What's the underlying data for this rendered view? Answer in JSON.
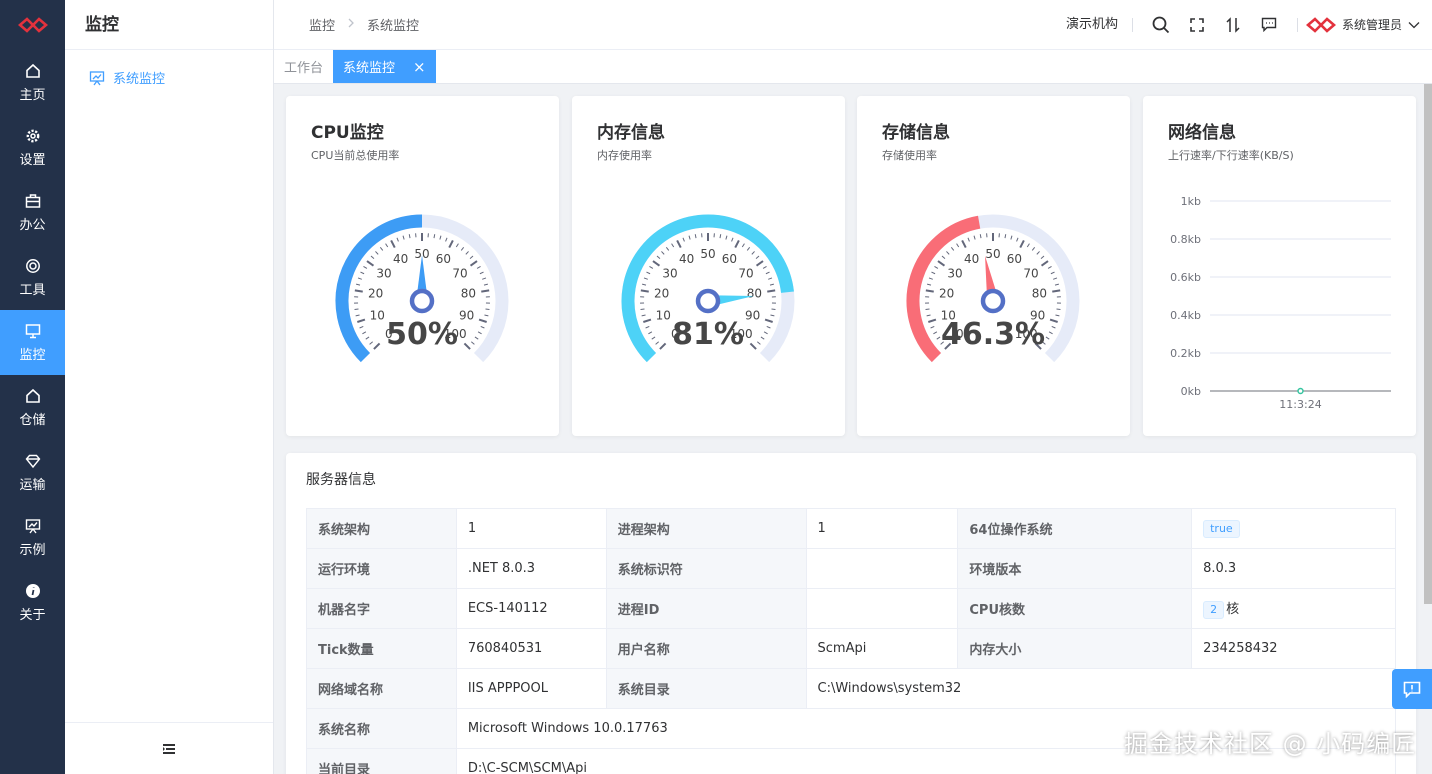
{
  "sidebar": {
    "items": [
      {
        "label": "主页",
        "icon": "home-icon"
      },
      {
        "label": "设置",
        "icon": "gear-icon"
      },
      {
        "label": "办公",
        "icon": "briefcase-icon"
      },
      {
        "label": "工具",
        "icon": "lifebuoy-icon"
      },
      {
        "label": "监控",
        "icon": "monitor-icon",
        "active": true
      },
      {
        "label": "仓储",
        "icon": "warehouse-icon"
      },
      {
        "label": "运输",
        "icon": "diamond-icon"
      },
      {
        "label": "示例",
        "icon": "presentation-icon"
      },
      {
        "label": "关于",
        "icon": "info-icon"
      }
    ]
  },
  "submenu": {
    "title": "监控",
    "items": [
      {
        "label": "系统监控",
        "icon": "chart-board-icon"
      }
    ]
  },
  "header": {
    "breadcrumb": [
      "监控",
      "系统监控"
    ],
    "org": "演示机构",
    "user": "系统管理员",
    "icons": [
      "search-icon",
      "fullscreen-icon",
      "sort-icon",
      "message-icon"
    ]
  },
  "tabs": [
    {
      "label": "工作台"
    },
    {
      "label": "系统监控",
      "active": true,
      "close": "×"
    }
  ],
  "cards": {
    "cpu": {
      "title": "CPU监控",
      "subtitle": "CPU当前总使用率",
      "value": 50,
      "display": "50%",
      "color": "#3d9cf5"
    },
    "memory": {
      "title": "内存信息",
      "subtitle": "内存使用率",
      "value": 81,
      "display": "81%",
      "color": "#4dd2f7"
    },
    "storage": {
      "title": "存储信息",
      "subtitle": "存储使用率",
      "value": 46.3,
      "display": "46.3%",
      "color": "#f96d77"
    },
    "network": {
      "title": "网络信息",
      "subtitle": "上行速率/下行速率(KB/S)"
    }
  },
  "gauge_ticks": [
    "0",
    "10",
    "20",
    "30",
    "40",
    "50",
    "60",
    "70",
    "80",
    "90",
    "100"
  ],
  "chart_data": {
    "type": "line",
    "x": [
      "11:3:24"
    ],
    "series": [
      {
        "values": [
          0
        ]
      }
    ],
    "y_ticks": [
      "0kb",
      "0.2kb",
      "0.4kb",
      "0.6kb",
      "0.8kb",
      "1kb"
    ],
    "ylim": [
      0,
      1
    ],
    "grid": true
  },
  "server": {
    "title": "服务器信息",
    "rows": [
      [
        {
          "k": "系统架构",
          "v": "1"
        },
        {
          "k": "进程架构",
          "v": "1"
        },
        {
          "k": "64位操作系统",
          "v": "true",
          "tag": true
        }
      ],
      [
        {
          "k": "运行环境",
          "v": ".NET 8.0.3"
        },
        {
          "k": "系统标识符",
          "v": ""
        },
        {
          "k": "环境版本",
          "v": "8.0.3"
        }
      ],
      [
        {
          "k": "机器名字",
          "v": "ECS-140112"
        },
        {
          "k": "进程ID",
          "v": ""
        },
        {
          "k": "CPU核数",
          "v": "2",
          "suffix": "核",
          "tag": true
        }
      ],
      [
        {
          "k": "Tick数量",
          "v": "760840531"
        },
        {
          "k": "用户名称",
          "v": "ScmApi"
        },
        {
          "k": "内存大小",
          "v": "234258432"
        }
      ],
      [
        {
          "k": "网络域名称",
          "v": "IIS APPPOOL"
        },
        {
          "k": "系统目录",
          "v": "C:\\Windows\\system32",
          "span": 3
        }
      ],
      [
        {
          "k": "系统名称",
          "v": "Microsoft Windows 10.0.17763",
          "span": 5
        }
      ],
      [
        {
          "k": "当前目录",
          "v": "D:\\C-SCM\\SCM\\Api",
          "span": 5
        }
      ]
    ]
  },
  "watermark": "掘金技术社区 @ 小码编匠"
}
